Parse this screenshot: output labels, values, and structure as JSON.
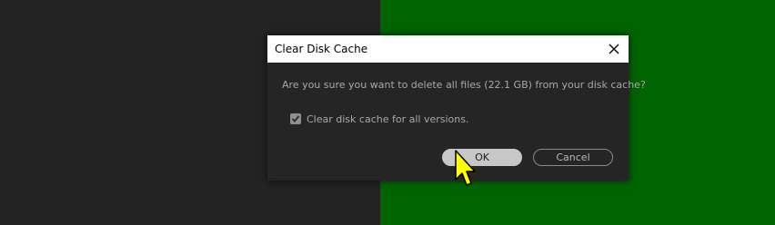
{
  "dialog": {
    "title": "Clear Disk Cache",
    "message": "Are you sure you want to delete all files (22.1 GB) from your disk cache?",
    "checkbox": {
      "label": "Clear disk cache for all versions.",
      "checked": true
    },
    "ok_label": "OK",
    "cancel_label": "Cancel"
  },
  "icons": {
    "close": "close-icon",
    "checkmark": "checkmark-icon",
    "cursor": "mouse-cursor-icon"
  },
  "colors": {
    "background_left": "#232323",
    "background_right": "#006400",
    "dialog_bg": "#252525",
    "cursor_fill": "#ffff00"
  }
}
